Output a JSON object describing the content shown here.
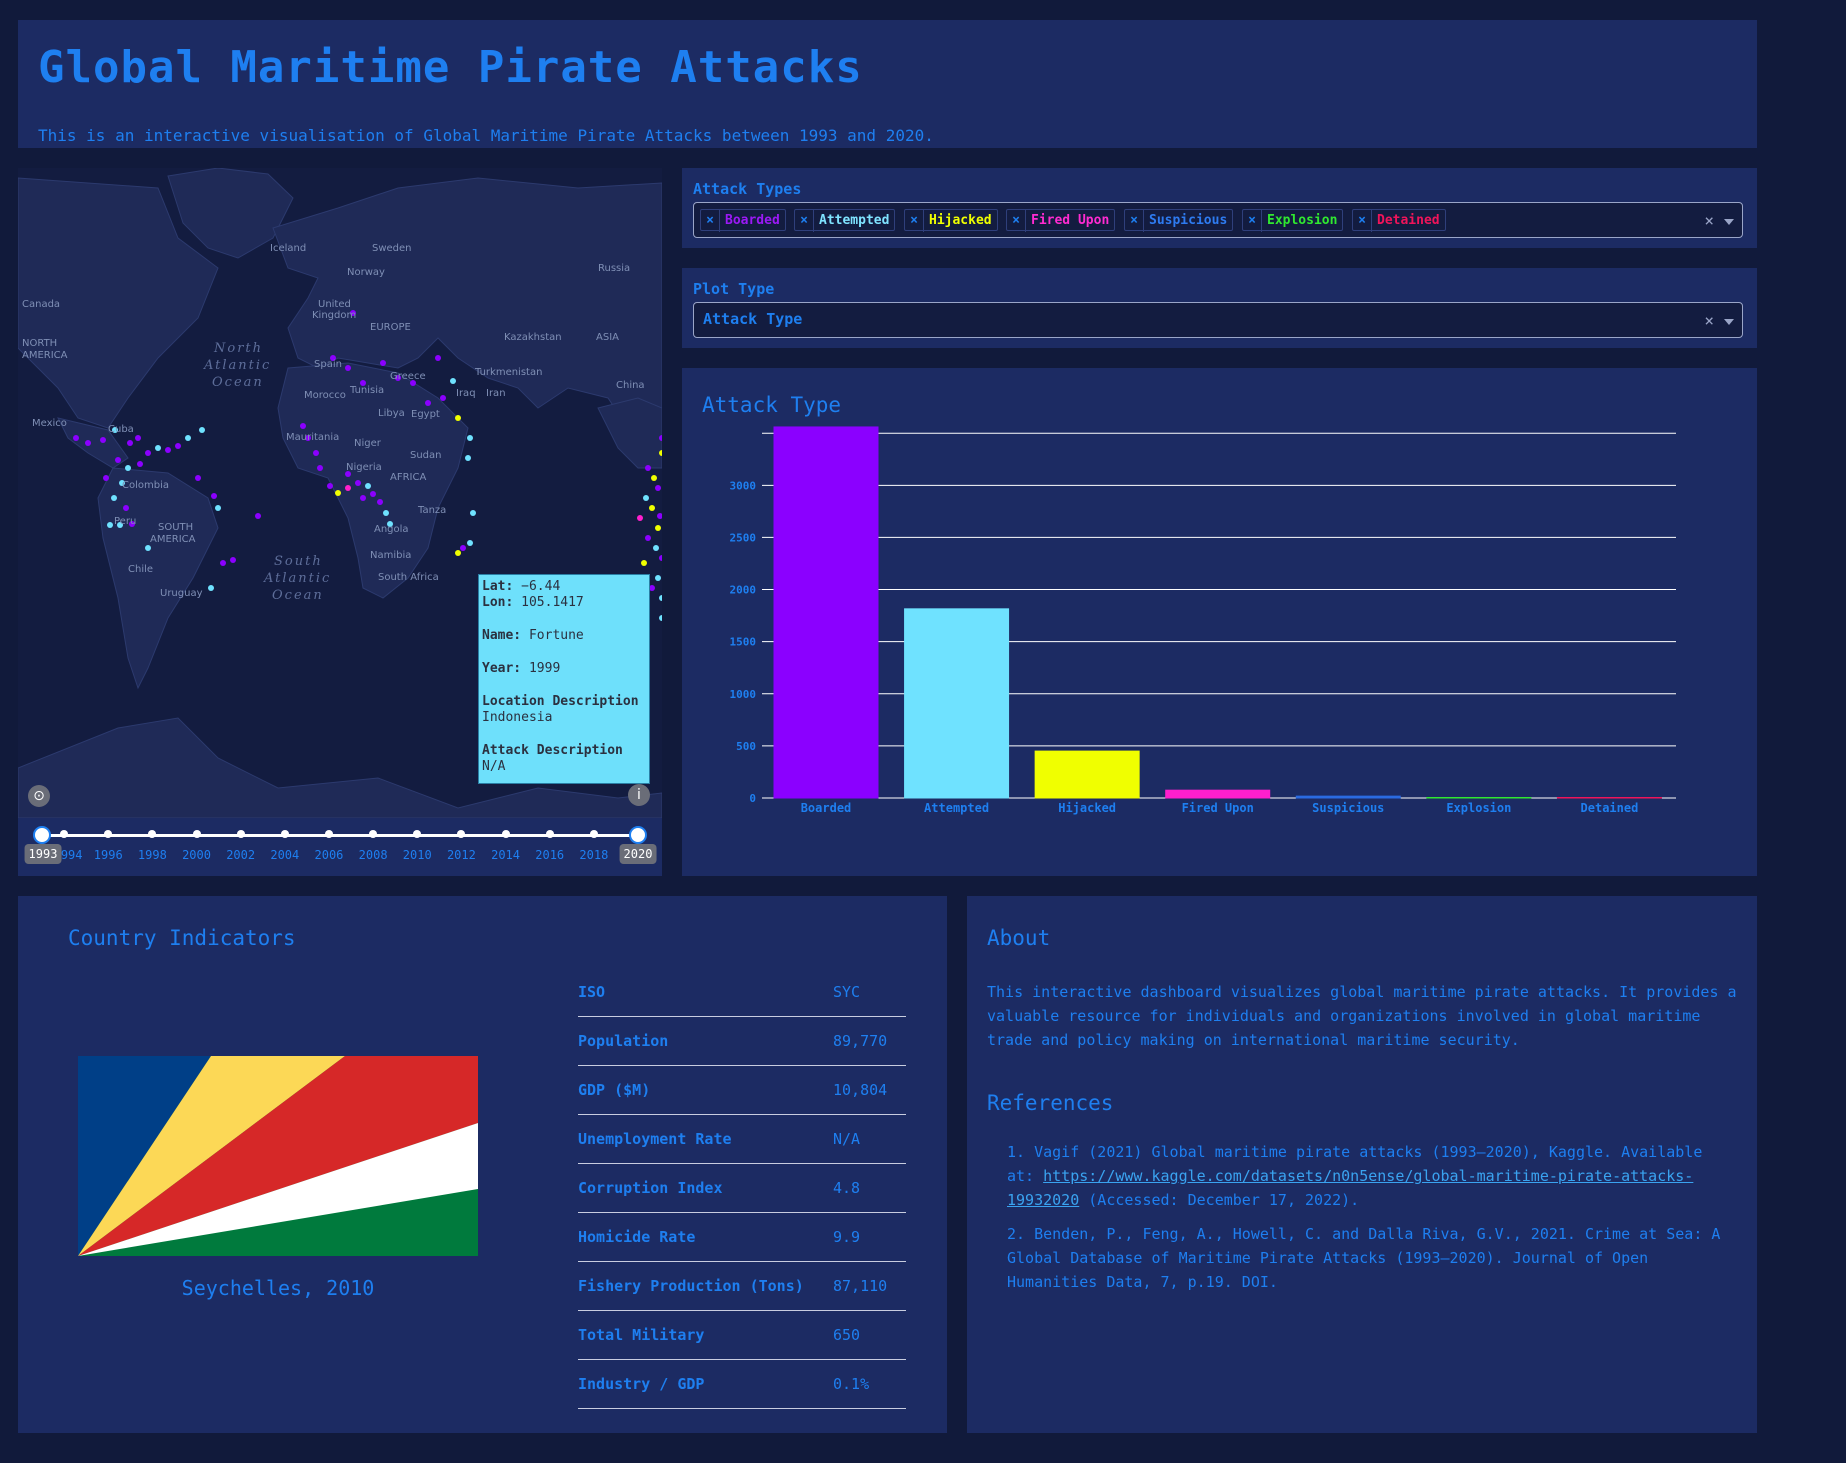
{
  "header": {
    "title": "Global Maritime Pirate Attacks",
    "subtitle": "This is an interactive visualisation of Global Maritime Pirate Attacks between 1993 and 2020."
  },
  "map": {
    "labels": {
      "iceland": "Iceland",
      "sweden": "Sweden",
      "norway": "Norway",
      "russia": "Russia",
      "canada": "Canada",
      "united": "United",
      "kingdom": "Kingdom",
      "europe": "EUROPE",
      "kazakhstan": "Kazakhstan",
      "asia": "ASIA",
      "north": "NORTH",
      "america": "AMERICA",
      "spain": "Spain",
      "greece": "Greece",
      "turkmenistan": "Turkmenistan",
      "china": "China",
      "morocco": "Morocco",
      "tunisia": "Tunisia",
      "iraq": "Iraq",
      "iran": "Iran",
      "mexico": "Mexico",
      "libya": "Libya",
      "egypt": "Egypt",
      "cuba": "Cuba",
      "mauritania": "Mauritania",
      "niger": "Niger",
      "sudan": "Sudan",
      "nigeria": "Nigeria",
      "africa": "AFRICA",
      "colombia": "Colombia",
      "tanzania": "Tanza",
      "peru": "Peru",
      "south": "SOUTH",
      "s_america": "AMERICA",
      "angola": "Angola",
      "namibia": "Namibia",
      "chile": "Chile",
      "south_africa": "South Africa",
      "uruguay": "Uruguay",
      "na_ocean1": "North",
      "na_ocean2": "Atlantic",
      "na_ocean3": "Ocean",
      "sa_ocean1": "South",
      "sa_ocean2": "Atlantic",
      "sa_ocean3": "Ocean"
    },
    "tooltip": {
      "lat_label": "Lat:",
      "lat": "−6.44",
      "lon_label": "Lon:",
      "lon": "105.1417",
      "name_label": "Name:",
      "name": "Fortune",
      "year_label": "Year:",
      "year": "1999",
      "loc_label": "Location Description",
      "loc": "Indonesia",
      "desc_label": "Attack Description",
      "desc": "N/A"
    },
    "compass_icon": "compass-icon",
    "info_icon": "info-icon"
  },
  "slider": {
    "years": [
      "1994",
      "1996",
      "1998",
      "2000",
      "2002",
      "2004",
      "2006",
      "2008",
      "2010",
      "2012",
      "2014",
      "2016",
      "2018"
    ],
    "start": "1993",
    "end": "2020"
  },
  "attack_types": {
    "label": "Attack Types",
    "chips": [
      {
        "label": "Boarded",
        "color": "#9b19f5"
      },
      {
        "label": "Attempted",
        "color": "#7fe3ff"
      },
      {
        "label": "Hijacked",
        "color": "#f0ff00"
      },
      {
        "label": "Fired Upon",
        "color": "#ff2bd1"
      },
      {
        "label": "Suspicious",
        "color": "#2e7bf0"
      },
      {
        "label": "Explosion",
        "color": "#30e830"
      },
      {
        "label": "Detained",
        "color": "#f0145a"
      }
    ],
    "clear": "×"
  },
  "plot_type": {
    "label": "Plot Type",
    "value": "Attack Type",
    "clear": "×"
  },
  "chart_data": {
    "type": "bar",
    "title": "Attack Type",
    "categories": [
      "Boarded",
      "Attempted",
      "Hijacked",
      "Fired Upon",
      "Suspicious",
      "Explosion",
      "Detained"
    ],
    "values": [
      3560,
      1815,
      450,
      75,
      18,
      2,
      1
    ],
    "colors": [
      "#8b00ff",
      "#6fe2ff",
      "#f0ff00",
      "#ff1fcd",
      "#2a6ae0",
      "#30e830",
      "#f0145a"
    ],
    "yticks": [
      0,
      500,
      1000,
      1500,
      2000,
      2500,
      3000
    ],
    "ylim": [
      0,
      3550
    ],
    "grid": true
  },
  "country": {
    "title": "Country Indicators",
    "caption": "Seychelles, 2010",
    "indicators": [
      {
        "k": "ISO",
        "v": "SYC"
      },
      {
        "k": "Population",
        "v": "89,770"
      },
      {
        "k": "GDP ($M)",
        "v": "10,804"
      },
      {
        "k": "Unemployment Rate",
        "v": "N/A"
      },
      {
        "k": "Corruption Index",
        "v": "4.8"
      },
      {
        "k": "Homicide Rate",
        "v": "9.9"
      },
      {
        "k": "Fishery Production (Tons)",
        "v": "87,110"
      },
      {
        "k": "Total Military",
        "v": "650"
      },
      {
        "k": "Industry / GDP",
        "v": "0.1%"
      }
    ],
    "flag_colors": {
      "blue": "#003f87",
      "yellow": "#fcd856",
      "red": "#d62828",
      "white": "#ffffff",
      "green": "#007a3d"
    }
  },
  "about": {
    "title": "About",
    "text1": "This interactive dashboard visualizes global maritime pirate attacks. It provides a",
    "text2": "valuable resource for individuals and organizations involved in global maritime",
    "text3": "trade and policy making on international maritime security.",
    "refs_title": "References",
    "ref1_pre": "1. Vagif (2021) Global maritime pirate attacks (1993–2020), Kaggle. Available at: ",
    "ref1_link": "https://www.kaggle.com/datasets/n0n5ense/global-maritime-pirate-attacks-19932020",
    "ref1_post": " (Accessed: December 17, 2022).",
    "ref2": "2. Benden, P., Feng, A., Howell, C. and Dalla Riva, G.V., 2021. Crime at Sea: A Global Database of Maritime Pirate Attacks (1993–2020). Journal of Open Humanities Data, 7, p.19. DOI."
  }
}
